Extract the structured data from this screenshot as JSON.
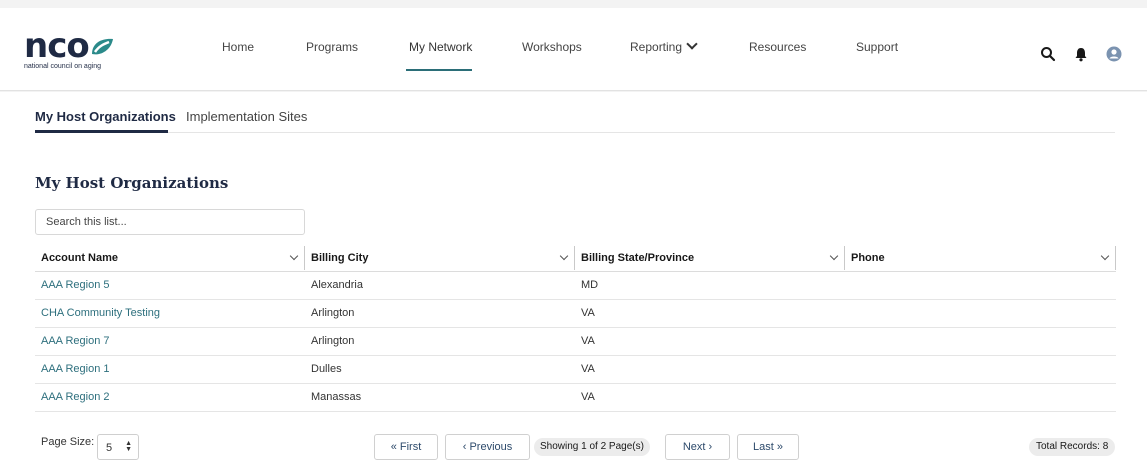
{
  "brand": {
    "wordmark": "nco",
    "tagline": "national council on aging",
    "accent": "#2b8a8a",
    "navy": "#1f2a44"
  },
  "nav": {
    "items": [
      {
        "label": "Home"
      },
      {
        "label": "Programs"
      },
      {
        "label": "My Network",
        "active": true
      },
      {
        "label": "Workshops"
      },
      {
        "label": "Reporting"
      },
      {
        "label": "Resources"
      },
      {
        "label": "Support"
      }
    ]
  },
  "header_icons": [
    "search-icon",
    "bell-icon",
    "user-avatar-icon"
  ],
  "tabs": [
    {
      "label": "My Host Organizations",
      "active": true
    },
    {
      "label": "Implementation Sites"
    }
  ],
  "page": {
    "title": "My Host Organizations"
  },
  "search": {
    "placeholder": "Search this list..."
  },
  "table": {
    "columns": [
      "Account Name",
      "Billing City",
      "Billing State/Province",
      "Phone"
    ],
    "rows": [
      [
        "AAA Region 5",
        "Alexandria",
        "MD",
        ""
      ],
      [
        "CHA Community Testing",
        "Arlington",
        "VA",
        ""
      ],
      [
        "AAA Region 7",
        "Arlington",
        "VA",
        ""
      ],
      [
        "AAA Region 1",
        "Dulles",
        "VA",
        ""
      ],
      [
        "AAA Region 2",
        "Manassas",
        "VA",
        ""
      ]
    ]
  },
  "pagination": {
    "page_size_label": "Page Size:",
    "page_size_value": "5",
    "first": "First",
    "previous": "Previous",
    "showing": "Showing 1 of 2 Page(s)",
    "next": "Next",
    "last": "Last",
    "total_records": "Total Records: 8"
  }
}
